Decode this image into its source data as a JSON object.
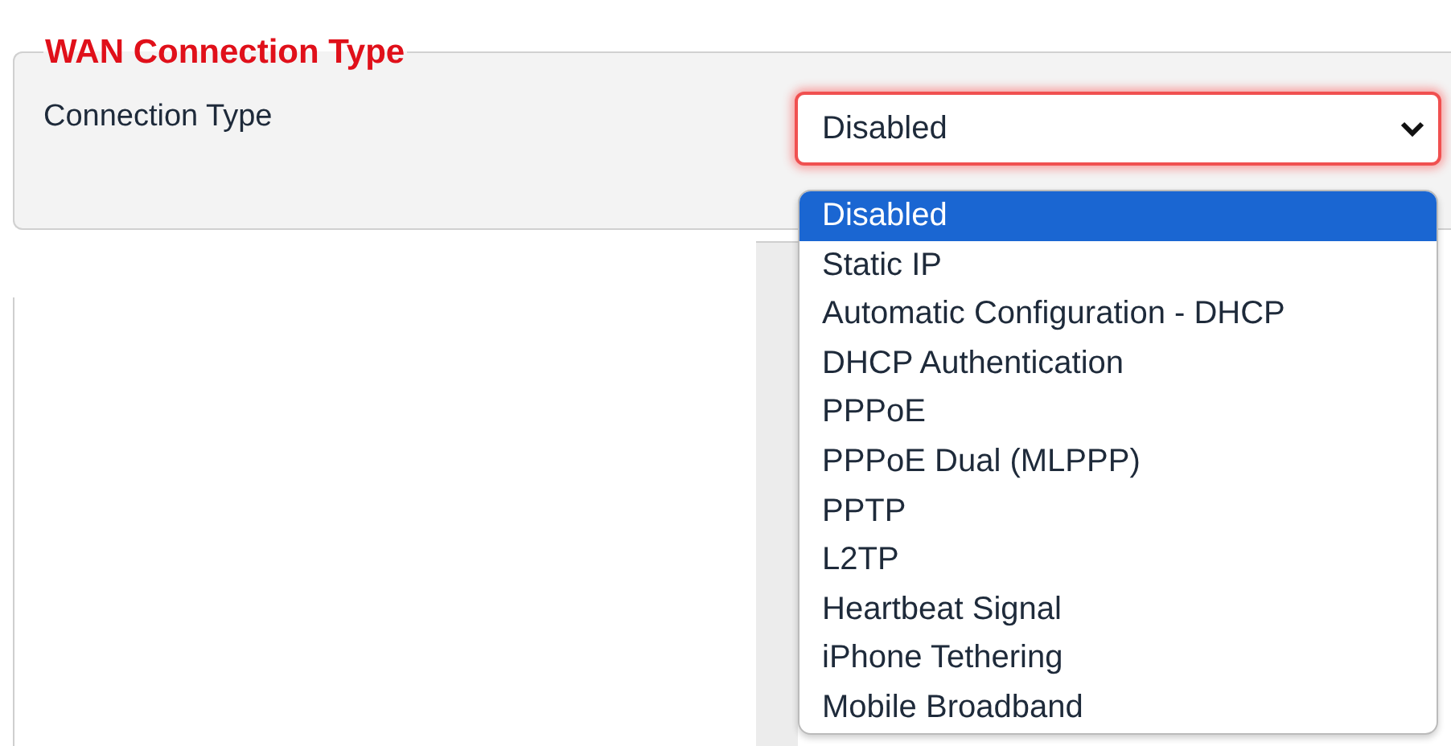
{
  "section": {
    "legend": "WAN Connection Type",
    "field": {
      "label": "Connection Type",
      "select": {
        "value": "Disabled",
        "expanded": true,
        "options": [
          {
            "label": "Disabled",
            "selected": true
          },
          {
            "label": "Static IP",
            "selected": false
          },
          {
            "label": "Automatic Configuration - DHCP",
            "selected": false
          },
          {
            "label": "DHCP Authentication",
            "selected": false
          },
          {
            "label": "PPPoE",
            "selected": false
          },
          {
            "label": "PPPoE Dual (MLPPP)",
            "selected": false
          },
          {
            "label": "PPTP",
            "selected": false
          },
          {
            "label": "L2TP",
            "selected": false
          },
          {
            "label": "Heartbeat Signal",
            "selected": false
          },
          {
            "label": "iPhone Tethering",
            "selected": false
          },
          {
            "label": "Mobile Broadband",
            "selected": false
          }
        ]
      }
    }
  }
}
